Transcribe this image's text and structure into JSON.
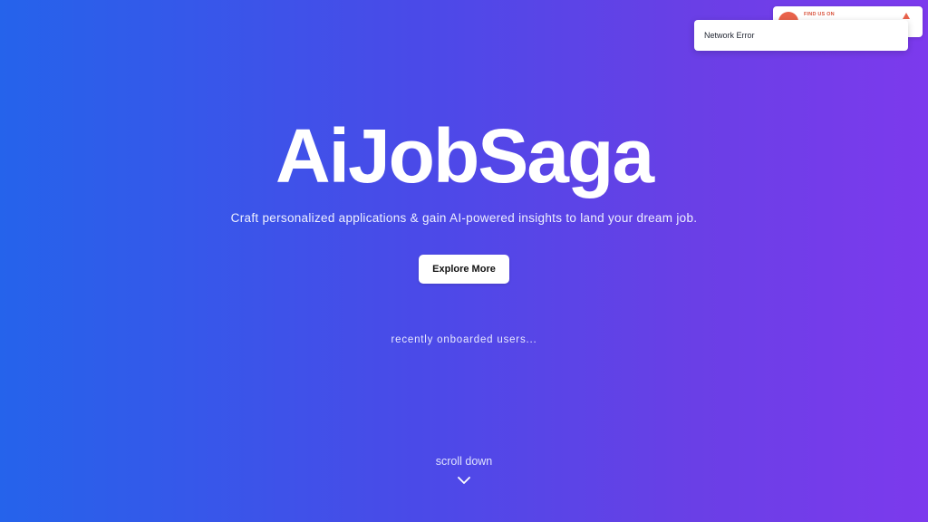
{
  "hero": {
    "title": "AiJobSaga",
    "tagline": "Craft personalized applications & gain AI-powered insights to land your dream job.",
    "cta_label": "Explore More",
    "onboarded_label": "recently onboarded users...",
    "scroll_label": "scroll down"
  },
  "banner": {
    "find_us_text": "FIND US ON"
  },
  "toast": {
    "message": "Network Error"
  },
  "colors": {
    "gradient_start": "#2563eb",
    "gradient_end": "#7c3aed",
    "banner_accent": "#e9624b"
  },
  "icons": {
    "scroll": "chevron-down-icon",
    "banner_logo": "logo-icon",
    "banner_vote": "upvote-icon"
  }
}
